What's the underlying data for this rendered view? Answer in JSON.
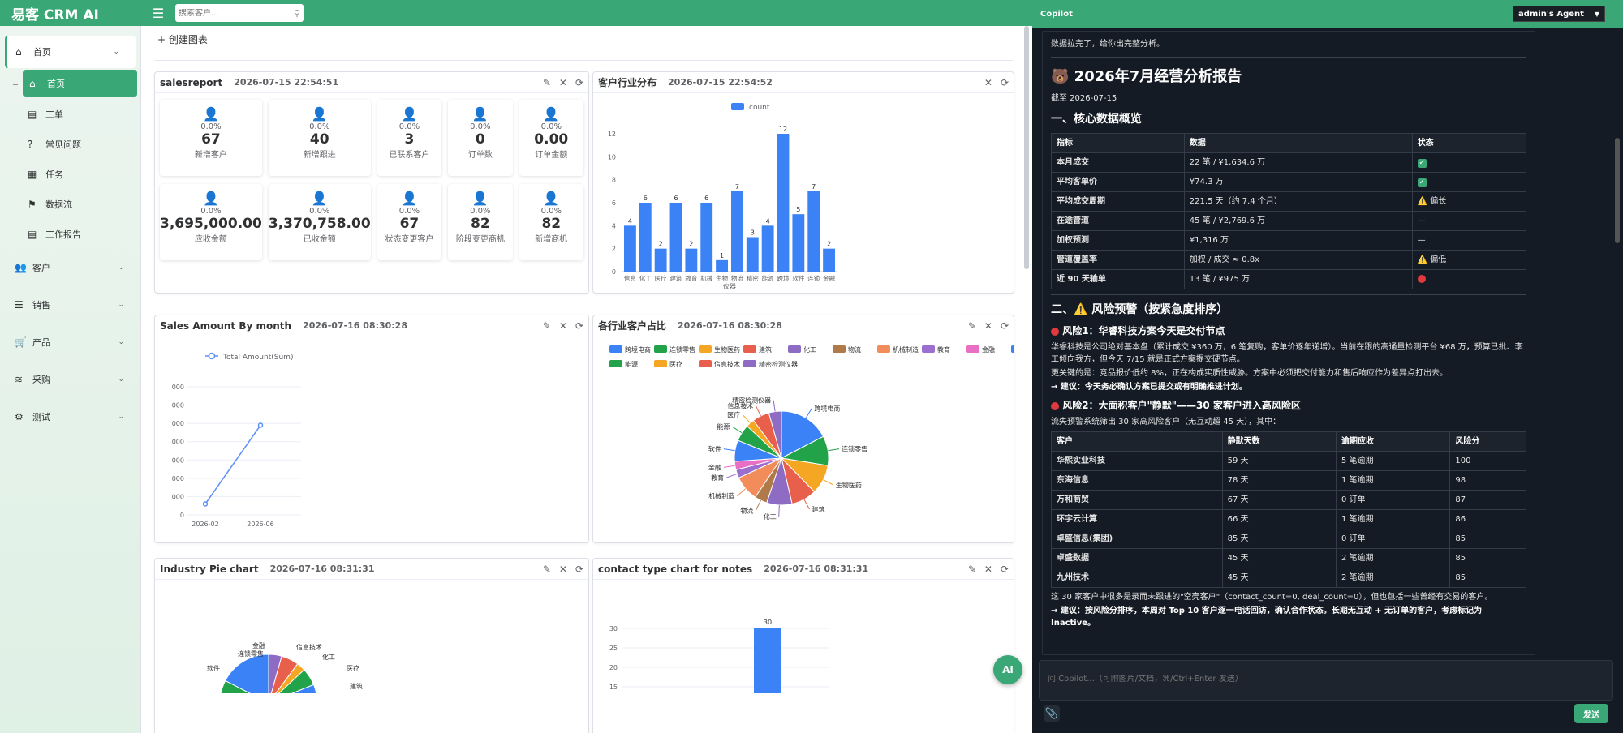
{
  "app": {
    "title": "易客 CRM AI"
  },
  "search": {
    "placeholder": "搜索客户..."
  },
  "sidebar": {
    "items": [
      {
        "label": "首页",
        "type": "group",
        "icon": "home-icon",
        "active": true
      },
      {
        "label": "首页",
        "type": "sub",
        "icon": "home-icon",
        "active": true
      },
      {
        "label": "工单",
        "type": "sub",
        "icon": "book-icon"
      },
      {
        "label": "常见问题",
        "type": "sub",
        "icon": "question-icon"
      },
      {
        "label": "任务",
        "type": "sub",
        "icon": "calendar-icon"
      },
      {
        "label": "数据流",
        "type": "sub",
        "icon": "flag-icon"
      },
      {
        "label": "工作报告",
        "type": "sub",
        "icon": "book-icon"
      },
      {
        "label": "客户",
        "type": "group",
        "icon": "users-icon"
      },
      {
        "label": "销售",
        "type": "group",
        "icon": "list-icon"
      },
      {
        "label": "产品",
        "type": "group",
        "icon": "cart-icon"
      },
      {
        "label": "采购",
        "type": "group",
        "icon": "layers-icon"
      },
      {
        "label": "测试",
        "type": "group",
        "icon": "gear-icon"
      }
    ]
  },
  "main": {
    "create_chart": "+ 创建图表",
    "ai_button": "AI"
  },
  "cards": {
    "salesreport": {
      "title": "salesreport",
      "time": "2026-07-15 22:54:51",
      "stats": [
        {
          "pct": "0.0%",
          "value": "67",
          "label": "新增客户",
          "color": "#2f6fd6"
        },
        {
          "pct": "0.0%",
          "value": "40",
          "label": "新增跟进",
          "color": "#3aa776"
        },
        {
          "pct": "0.0%",
          "value": "3",
          "label": "已联系客户",
          "color": "#e6b422"
        },
        {
          "pct": "0.0%",
          "value": "0",
          "label": "订单数",
          "color": "#22b5c4"
        },
        {
          "pct": "0.0%",
          "value": "0.00",
          "label": "订单金额",
          "color": "#d63b4a"
        },
        {
          "pct": "0.0%",
          "value": "3,695,000.00",
          "label": "应收金额",
          "color": "#2f6fd6"
        },
        {
          "pct": "0.0%",
          "value": "3,370,758.00",
          "label": "已收金额",
          "color": "#3aa776"
        },
        {
          "pct": "0.0%",
          "value": "67",
          "label": "状态变更客户",
          "color": "#e6b422"
        },
        {
          "pct": "0.0%",
          "value": "82",
          "label": "阶段变更商机",
          "color": "#22b5c4"
        },
        {
          "pct": "0.0%",
          "value": "82",
          "label": "新增商机",
          "color": "#d63b4a"
        }
      ]
    },
    "industry_bar": {
      "title": "客户行业分布",
      "time": "2026-07-15 22:54:52"
    },
    "sales_month": {
      "title": "Sales Amount By month",
      "time": "2026-07-16 08:30:28"
    },
    "industry_share": {
      "title": "各行业客户占比",
      "time": "2026-07-16 08:30:28"
    },
    "industry_pie": {
      "title": "Industry Pie chart",
      "time": "2026-07-16 08:31:31"
    },
    "contact_type": {
      "title": "contact type chart for notes",
      "time": "2026-07-16 08:31:31"
    }
  },
  "chart_data": [
    {
      "type": "bar",
      "categories": [
        "信息技术",
        "化工",
        "医疗",
        "建筑",
        "教育",
        "机械制造",
        "生物医药",
        "物流",
        "精密检测仪器",
        "能源",
        "跨境电商",
        "软件",
        "连锁零售",
        "金融"
      ],
      "series": [
        {
          "name": "count",
          "values": [
            4,
            6,
            2,
            6,
            2,
            6,
            1,
            7,
            3,
            4,
            12,
            5,
            7,
            2
          ]
        }
      ],
      "xlabel": "仪器",
      "ylabel": "",
      "ylim": [
        0,
        12
      ],
      "yticks": [
        0,
        2,
        4,
        6,
        8,
        10,
        12
      ],
      "legend": "top",
      "color": "#3b82f6"
    },
    {
      "type": "line",
      "categories": [
        "2026-02",
        "2026-06"
      ],
      "series": [
        {
          "name": "Total Amount(Sum)",
          "values": [
            0.6,
            4.9
          ]
        }
      ],
      "yticks": [
        "0",
        "000",
        "000",
        "000",
        "000",
        "000",
        "000",
        "000"
      ],
      "legend": "top",
      "color": "#5b8ff9"
    },
    {
      "type": "pie",
      "legend_items": [
        "跨境电商",
        "连锁零售",
        "生物医药",
        "建筑",
        "化工",
        "物流",
        "机械制造",
        "教育",
        "金融",
        "软件",
        "能源",
        "医疗",
        "信息技术",
        "精密检测仪器"
      ],
      "slices": [
        {
          "name": "跨境电商",
          "value": 12,
          "color": "#3b82f6"
        },
        {
          "name": "连锁零售",
          "value": 7,
          "color": "#22a34a"
        },
        {
          "name": "生物医药",
          "value": 7,
          "color": "#f5a623"
        },
        {
          "name": "建筑",
          "value": 6,
          "color": "#e8604c"
        },
        {
          "name": "化工",
          "value": 6,
          "color": "#8e6cc4"
        },
        {
          "name": "物流",
          "value": 3,
          "color": "#b0794a"
        },
        {
          "name": "机械制造",
          "value": 6,
          "color": "#f28c5a"
        },
        {
          "name": "教育",
          "value": 2,
          "color": "#9b6fd0"
        },
        {
          "name": "金融",
          "value": 2,
          "color": "#e86fc4"
        },
        {
          "name": "软件",
          "value": 5,
          "color": "#3b82f6"
        },
        {
          "name": "能源",
          "value": 4,
          "color": "#22a34a"
        },
        {
          "name": "医疗",
          "value": 2,
          "color": "#f5a623"
        },
        {
          "name": "信息技术",
          "value": 4,
          "color": "#e8604c"
        },
        {
          "name": "精密检测仪器",
          "value": 3,
          "color": "#8e6cc4"
        }
      ]
    },
    {
      "type": "pie",
      "visible_labels": [
        "金融",
        "信息技术",
        "连锁零售",
        "化工",
        "软件",
        "医疗",
        "建筑"
      ]
    },
    {
      "type": "bar",
      "visible_values": [
        30
      ],
      "yticks": [
        15,
        20,
        25,
        30
      ],
      "color": "#3b82f6"
    }
  ],
  "copilot": {
    "title": "Copilot",
    "agent": "admin's Agent",
    "intro": "数据拉完了，给你出完整分析。",
    "report_title": "🐻 2026年7月经营分析报告",
    "report_date": "截至 2026-07-15",
    "sec1": "一、核心数据概览",
    "t1_headers": [
      "指标",
      "数据",
      "状态"
    ],
    "t1_rows": [
      {
        "k": "本月成交",
        "v": "22 笔 / ¥1,634.6 万",
        "s": "",
        "st": "ok"
      },
      {
        "k": "平均客单价",
        "v": "¥74.3 万",
        "s": "",
        "st": "ok"
      },
      {
        "k": "平均成交周期",
        "v": "221.5 天（约 7.4 个月）",
        "s": "⚠️ 偏长",
        "st": "warn"
      },
      {
        "k": "在途管道",
        "v": "45 笔 / ¥2,769.6 万",
        "s": "—",
        "st": "none"
      },
      {
        "k": "加权预测",
        "v": "¥1,316 万",
        "s": "—",
        "st": "none"
      },
      {
        "k": "管道覆盖率",
        "v": "加权 / 成交 ≈ 0.8x",
        "s": "⚠️ 偏低",
        "st": "warn"
      },
      {
        "k": "近 90 天输单",
        "v": "13 笔 / ¥975 万",
        "s": "",
        "st": "bad"
      }
    ],
    "sec2": "二、⚠️ 风险预警（按紧急度排序）",
    "risk1_title": "风险1：华睿科技方案今天是交付节点",
    "risk1_p1": "华睿科技是公司绝对基本盘（累计成交 ¥360 万，6 笔复购，客单价逐年递增）。当前在跟的高通量检测平台 ¥68 万，预算已批、李工倾向我方，但今天 7/15 就是正式方案提交硬节点。",
    "risk1_p2": "更关键的是：竞品报价低约 8%，正在构成实质性威胁。方案中必须把交付能力和售后响应作为差异点打出去。",
    "risk1_p3": "→ 建议：今天务必确认方案已提交或有明确推进计划。",
    "risk2_title": "风险2：大面积客户\"静默\"——30 家客户进入高风险区",
    "risk2_p1": "流失预警系统筛出 30 家高风险客户（无互动超 45 天），其中：",
    "t2_headers": [
      "客户",
      "静默天数",
      "逾期应收",
      "风险分"
    ],
    "t2_rows": [
      [
        "华熙实业科技",
        "59 天",
        "5 笔逾期",
        "100"
      ],
      [
        "东海信息",
        "78 天",
        "1 笔逾期",
        "98"
      ],
      [
        "万和商贸",
        "67 天",
        "0 订单",
        "87"
      ],
      [
        "环宇云计算",
        "66 天",
        "1 笔逾期",
        "86"
      ],
      [
        "卓盛信息(集团)",
        "85 天",
        "0 订单",
        "85"
      ],
      [
        "卓盛数据",
        "45 天",
        "2 笔逾期",
        "85"
      ],
      [
        "九州技术",
        "45 天",
        "2 笔逾期",
        "85"
      ]
    ],
    "risk2_p2": "这 30 家客户中很多是录而未跟进的\"空壳客户\"（contact_count=0, deal_count=0），但也包括一些曾经有交易的客户。",
    "risk2_p3": "→ 建议：按风险分排序，本周对 Top 10 客户逐一电话回访，确认合作状态。长期无互动 + 无订单的客户，考虑标记为 Inactive。",
    "input_placeholder": "问 Copilot...（可附图片/文档，⌘/Ctrl+Enter 发送）",
    "send": "发送"
  }
}
